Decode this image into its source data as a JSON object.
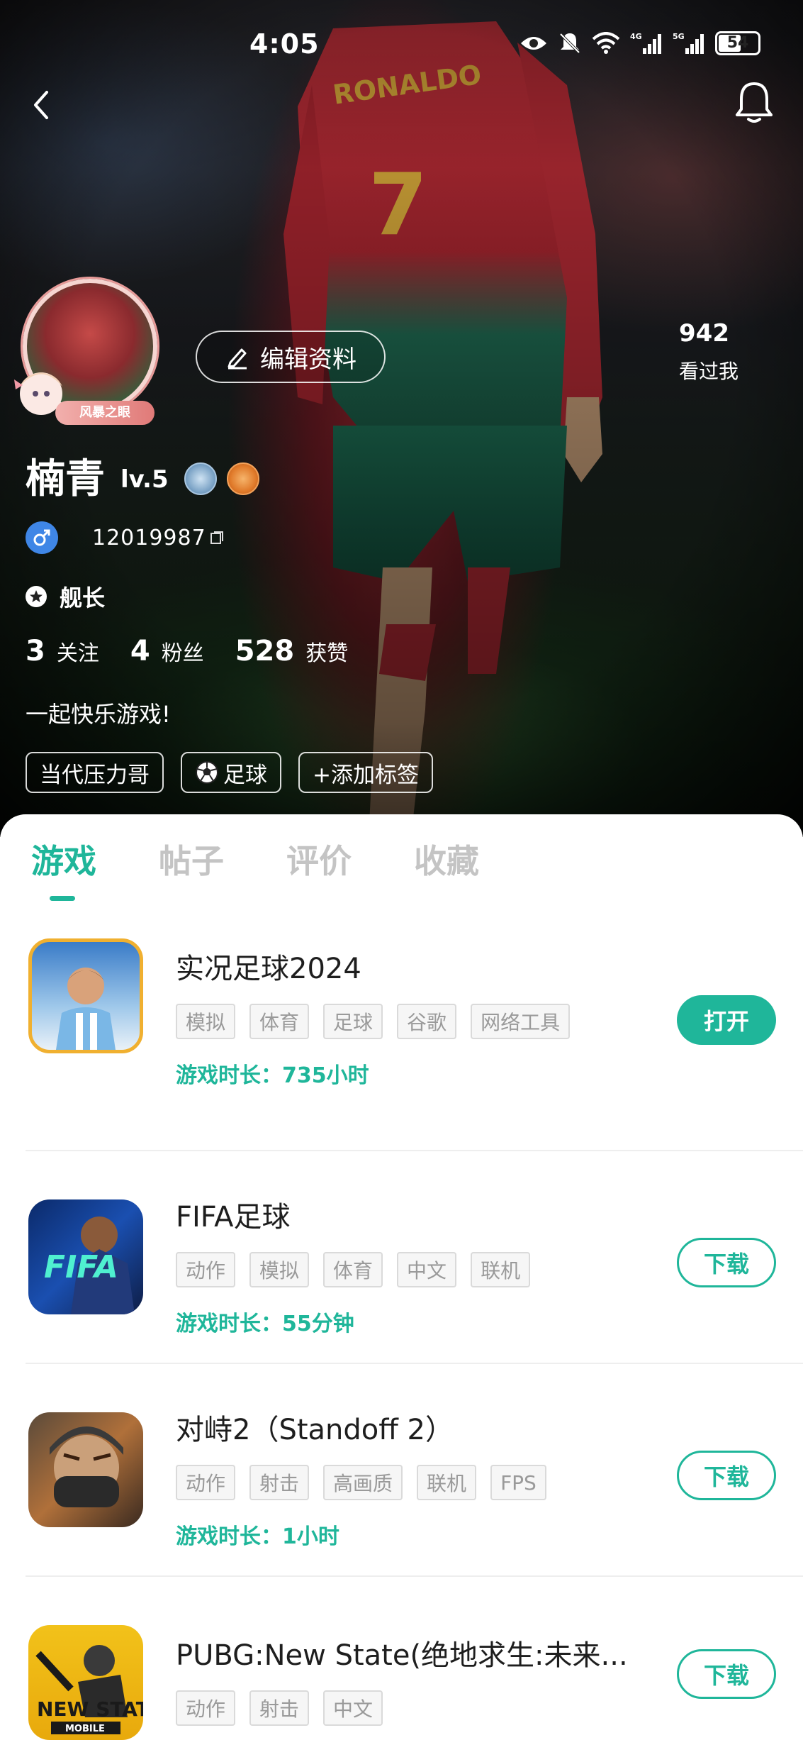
{
  "status_bar": {
    "time": "4:05",
    "battery": "54",
    "net1": "4G",
    "net2": "5G"
  },
  "profile": {
    "avatar_badge": "风暴之眼",
    "edit_button": "编辑资料",
    "viewed_count": "942",
    "viewed_label": "看过我",
    "name": "楠青",
    "level": "lv.5",
    "uid": "12019987",
    "rank": "舰长",
    "stats": [
      {
        "value": "3",
        "label": "关注"
      },
      {
        "value": "4",
        "label": "粉丝"
      },
      {
        "value": "528",
        "label": "获赞"
      }
    ],
    "bio": "一起快乐游戏!",
    "tags": [
      "当代压力哥",
      "足球",
      "+添加标签"
    ]
  },
  "tabs": [
    "游戏",
    "帖子",
    "评价",
    "收藏"
  ],
  "games": [
    {
      "title": "实况足球2024",
      "tags": [
        "模拟",
        "体育",
        "足球",
        "谷歌",
        "网络工具"
      ],
      "playtime": "游戏时长：735小时",
      "button": "打开"
    },
    {
      "title": "FIFA足球",
      "tags": [
        "动作",
        "模拟",
        "体育",
        "中文",
        "联机"
      ],
      "playtime": "游戏时长：55分钟",
      "button": "下载"
    },
    {
      "title": "对峙2（Standoff 2）",
      "tags": [
        "动作",
        "射击",
        "高画质",
        "联机",
        "FPS"
      ],
      "playtime": "游戏时长：1小时",
      "button": "下载"
    },
    {
      "title": "PUBG:New State(绝地求生:未来...",
      "tags": [
        "动作",
        "射击",
        "中文"
      ],
      "playtime": "",
      "button": "下载"
    }
  ],
  "icon_texts": {
    "fifa": "FIFA",
    "newstate": "NEW STATE",
    "mobile": "MOBILE"
  },
  "colors": {
    "accent": "#1fb69a",
    "gender": "#3f86e6"
  }
}
